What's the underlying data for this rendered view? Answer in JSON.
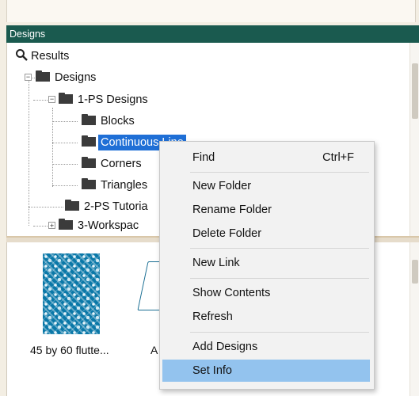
{
  "panel": {
    "title": "Designs"
  },
  "tree": {
    "results_label": "Results",
    "root_label": "Designs",
    "folder_1ps": "1-PS Designs",
    "children": [
      "Blocks",
      "Continuous Line",
      "Corners",
      "Triangles"
    ],
    "folder_2ps": "2-PS Tutoria",
    "folder_3ws": "3-Workspac",
    "selected": "Continuous Line"
  },
  "gallery": {
    "item1_caption": "45 by 60 flutte...",
    "item2_caption": "A"
  },
  "context_menu": {
    "find": "Find",
    "find_shortcut": "Ctrl+F",
    "new_folder": "New Folder",
    "rename_folder": "Rename Folder",
    "delete_folder": "Delete Folder",
    "new_link": "New Link",
    "show_contents": "Show Contents",
    "refresh": "Refresh",
    "add_designs": "Add Designs",
    "set_info": "Set Info",
    "highlighted": "Set Info"
  },
  "colors": {
    "header_bg": "#1a5a4f",
    "selection": "#1f6fd6",
    "menu_highlight": "#93c3ee"
  }
}
